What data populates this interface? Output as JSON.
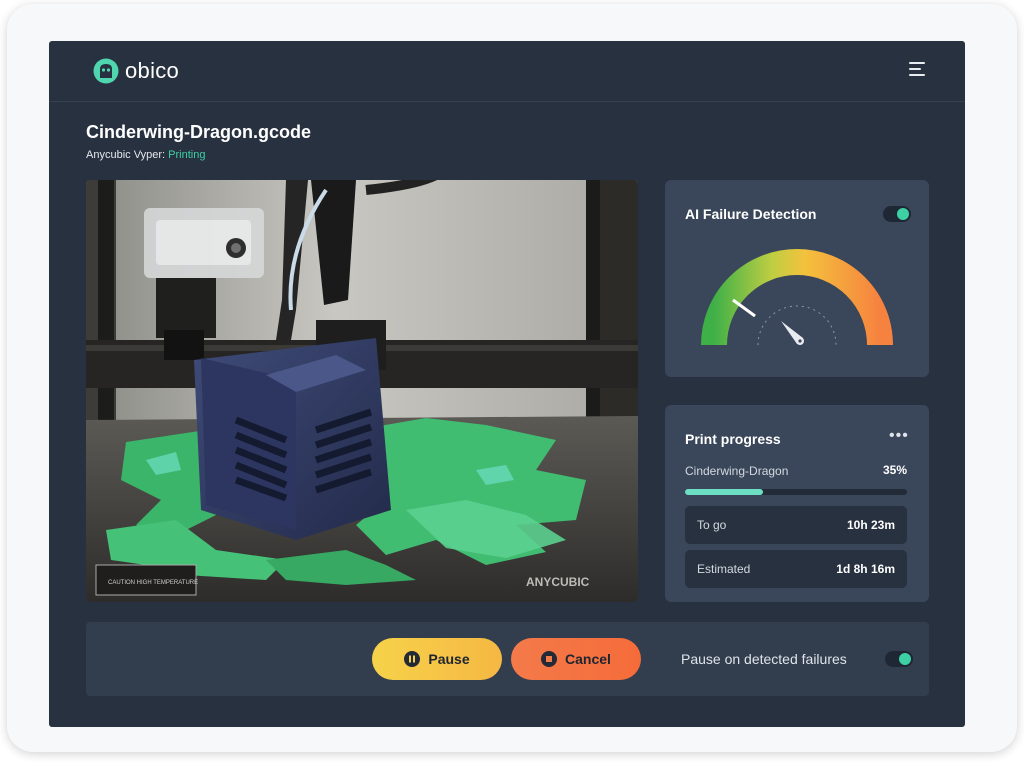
{
  "app": {
    "name": "obico"
  },
  "job": {
    "filename": "Cinderwing-Dragon.gcode",
    "printer": "Anycubic Vyper:",
    "status": "Printing"
  },
  "ai_detection": {
    "title": "AI Failure Detection",
    "enabled": true,
    "risk_level": 0.14
  },
  "progress": {
    "title": "Print progress",
    "more_icon": "•••",
    "name": "Cinderwing-Dragon",
    "percent_label": "35%",
    "percent": 0.35,
    "to_go_label": "To go",
    "to_go_value": "10h 23m",
    "estimated_label": "Estimated",
    "estimated_value": "1d 8h 16m"
  },
  "controls": {
    "pause_label": "Pause",
    "cancel_label": "Cancel",
    "auto_pause_label": "Pause on detected failures",
    "auto_pause_enabled": true
  },
  "camera": {
    "bed_brand": "ANYCUBIC",
    "bed_warning": "CAUTION HIGH TEMPERATURE"
  },
  "colors": {
    "accent": "#3ed0a5",
    "background": "#27313f",
    "card": "#3a4659",
    "pause": "#f6d24a",
    "cancel": "#f56c3a"
  }
}
